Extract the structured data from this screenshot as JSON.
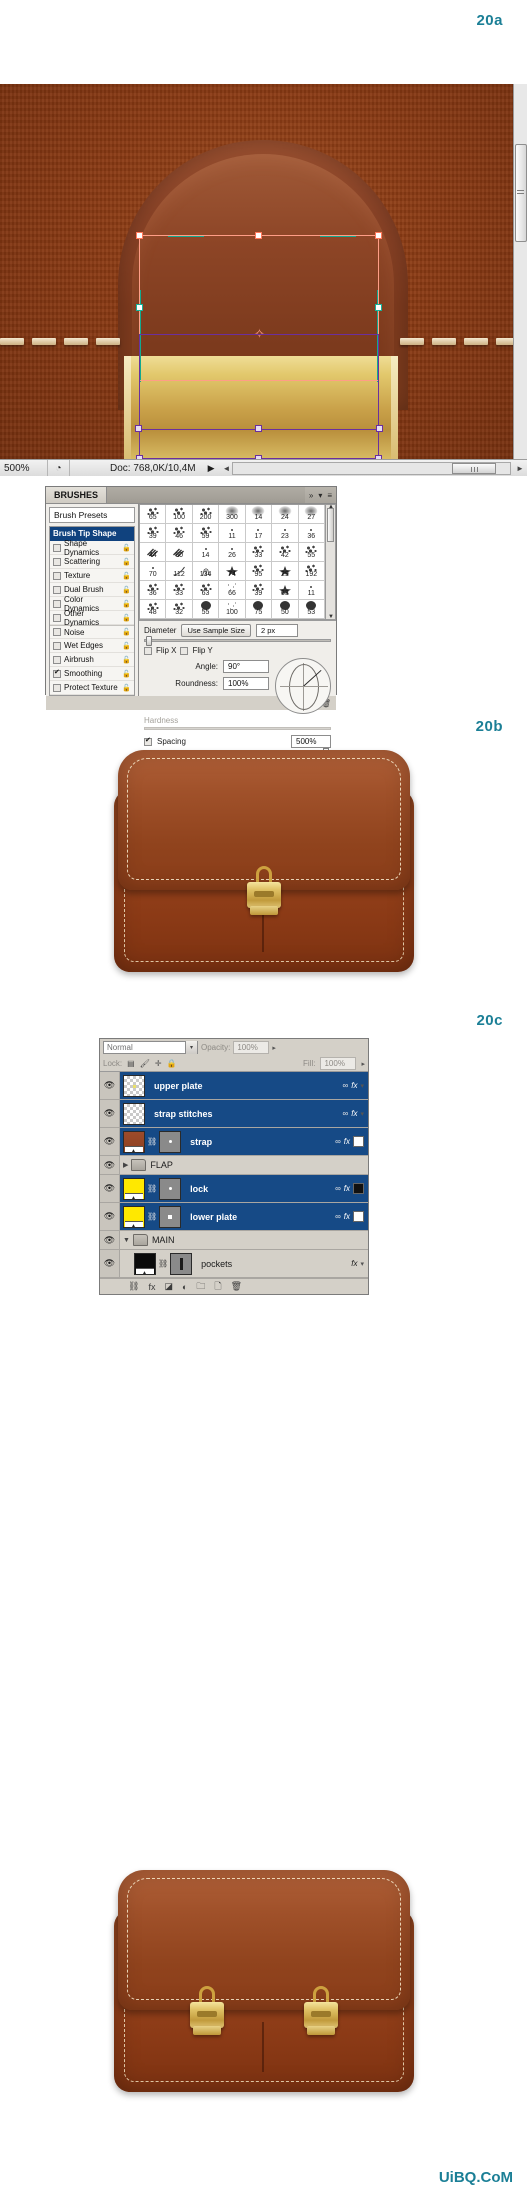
{
  "captions": {
    "a": "20a",
    "b": "20b",
    "c": "20c"
  },
  "brand": "UiBQ.CoM",
  "colors": {
    "caption": "#1b7f96",
    "layer_selected": "#164a86",
    "panel_bg": "#d4d0c8"
  },
  "photoshop_canvas": {
    "statusbar": {
      "zoom": "500%",
      "doc_info": "Doc: 768,0K/10,4M",
      "play_arrow": "▶",
      "left_arrow": "◄",
      "right_arrow": "►"
    }
  },
  "brushes_panel": {
    "tab_label": "BRUSHES",
    "tab_buttons": [
      "»",
      "▾",
      "≡"
    ],
    "presets_label": "Brush Presets",
    "options": [
      {
        "label": "Brush Tip Shape",
        "checked": null,
        "selected": true,
        "locked": false
      },
      {
        "label": "Shape Dynamics",
        "checked": false,
        "selected": false,
        "locked": true
      },
      {
        "label": "Scattering",
        "checked": false,
        "selected": false,
        "locked": true
      },
      {
        "label": "Texture",
        "checked": false,
        "selected": false,
        "locked": true
      },
      {
        "label": "Dual Brush",
        "checked": false,
        "selected": false,
        "locked": true
      },
      {
        "label": "Color Dynamics",
        "checked": false,
        "selected": false,
        "locked": true
      },
      {
        "label": "Other Dynamics",
        "checked": false,
        "selected": false,
        "locked": true
      },
      {
        "label": "Noise",
        "checked": false,
        "selected": false,
        "locked": true
      },
      {
        "label": "Wet Edges",
        "checked": false,
        "selected": false,
        "locked": true
      },
      {
        "label": "Airbrush",
        "checked": false,
        "selected": false,
        "locked": true
      },
      {
        "label": "Smoothing",
        "checked": true,
        "selected": false,
        "locked": true
      },
      {
        "label": "Protect Texture",
        "checked": false,
        "selected": false,
        "locked": true
      }
    ],
    "brush_grid": [
      [
        "65",
        "100",
        "200",
        "300",
        "14",
        "24",
        "27"
      ],
      [
        "39",
        "46",
        "59",
        "11",
        "17",
        "23",
        "36"
      ],
      [
        "44",
        "60",
        "14",
        "26",
        "33",
        "42",
        "55"
      ],
      [
        "70",
        "112",
        "134",
        "74",
        "95",
        "29",
        "192"
      ],
      [
        "36",
        "33",
        "63",
        "66",
        "39",
        "63",
        "11"
      ],
      [
        "48",
        "32",
        "55",
        "100",
        "75",
        "50",
        "53"
      ]
    ],
    "diameter_label": "Diameter",
    "use_sample_size": "Use Sample Size",
    "diameter_value": "2 px",
    "flip_x": "Flip X",
    "flip_y": "Flip Y",
    "angle_label": "Angle:",
    "angle_value": "90°",
    "roundness_label": "Roundness:",
    "roundness_value": "100%",
    "hardness_label": "Hardness",
    "spacing_label": "Spacing",
    "spacing_value": "500%",
    "footer_icons": [
      "new-brush",
      "delete-brush"
    ]
  },
  "layers_panel": {
    "blend_mode": "Normal",
    "opacity_label": "Opacity:",
    "opacity_value": "100%",
    "lock_label": "Lock:",
    "lock_icons": [
      "transparency",
      "paint",
      "move",
      "all"
    ],
    "fill_label": "Fill:",
    "fill_value": "100%",
    "layers": [
      {
        "name": "upper plate",
        "type": "layer",
        "selected": true,
        "thumb": "alpha",
        "has_mask": false,
        "link": true,
        "right": "∞ fx ▾"
      },
      {
        "name": "strap stitches",
        "type": "layer",
        "selected": true,
        "thumb": "alpha",
        "has_mask": false,
        "link": true,
        "right": "∞ fx ▾"
      },
      {
        "name": "strap",
        "type": "layer",
        "selected": true,
        "thumb": "brown",
        "has_mask": true,
        "link": true,
        "right": "∞ fx ▾"
      },
      {
        "name": "FLAP",
        "type": "group",
        "selected": false,
        "expanded": false
      },
      {
        "name": "lock",
        "type": "layer",
        "selected": true,
        "thumb": "yellow",
        "has_mask": true,
        "link": true,
        "right": "∞ fx ▾"
      },
      {
        "name": "lower plate",
        "type": "layer",
        "selected": true,
        "thumb": "yellow",
        "has_mask": true,
        "link": true,
        "right": "∞ fx ▾"
      },
      {
        "name": "MAIN",
        "type": "group",
        "selected": false,
        "expanded": true
      },
      {
        "name": "pockets",
        "type": "layer",
        "selected": false,
        "thumb": "black",
        "has_mask": true,
        "link": true,
        "right": "fx ▾"
      }
    ],
    "footer_icons": [
      "link-layers",
      "add-style",
      "add-mask",
      "new-group",
      "new-layer",
      "delete-layer"
    ]
  }
}
